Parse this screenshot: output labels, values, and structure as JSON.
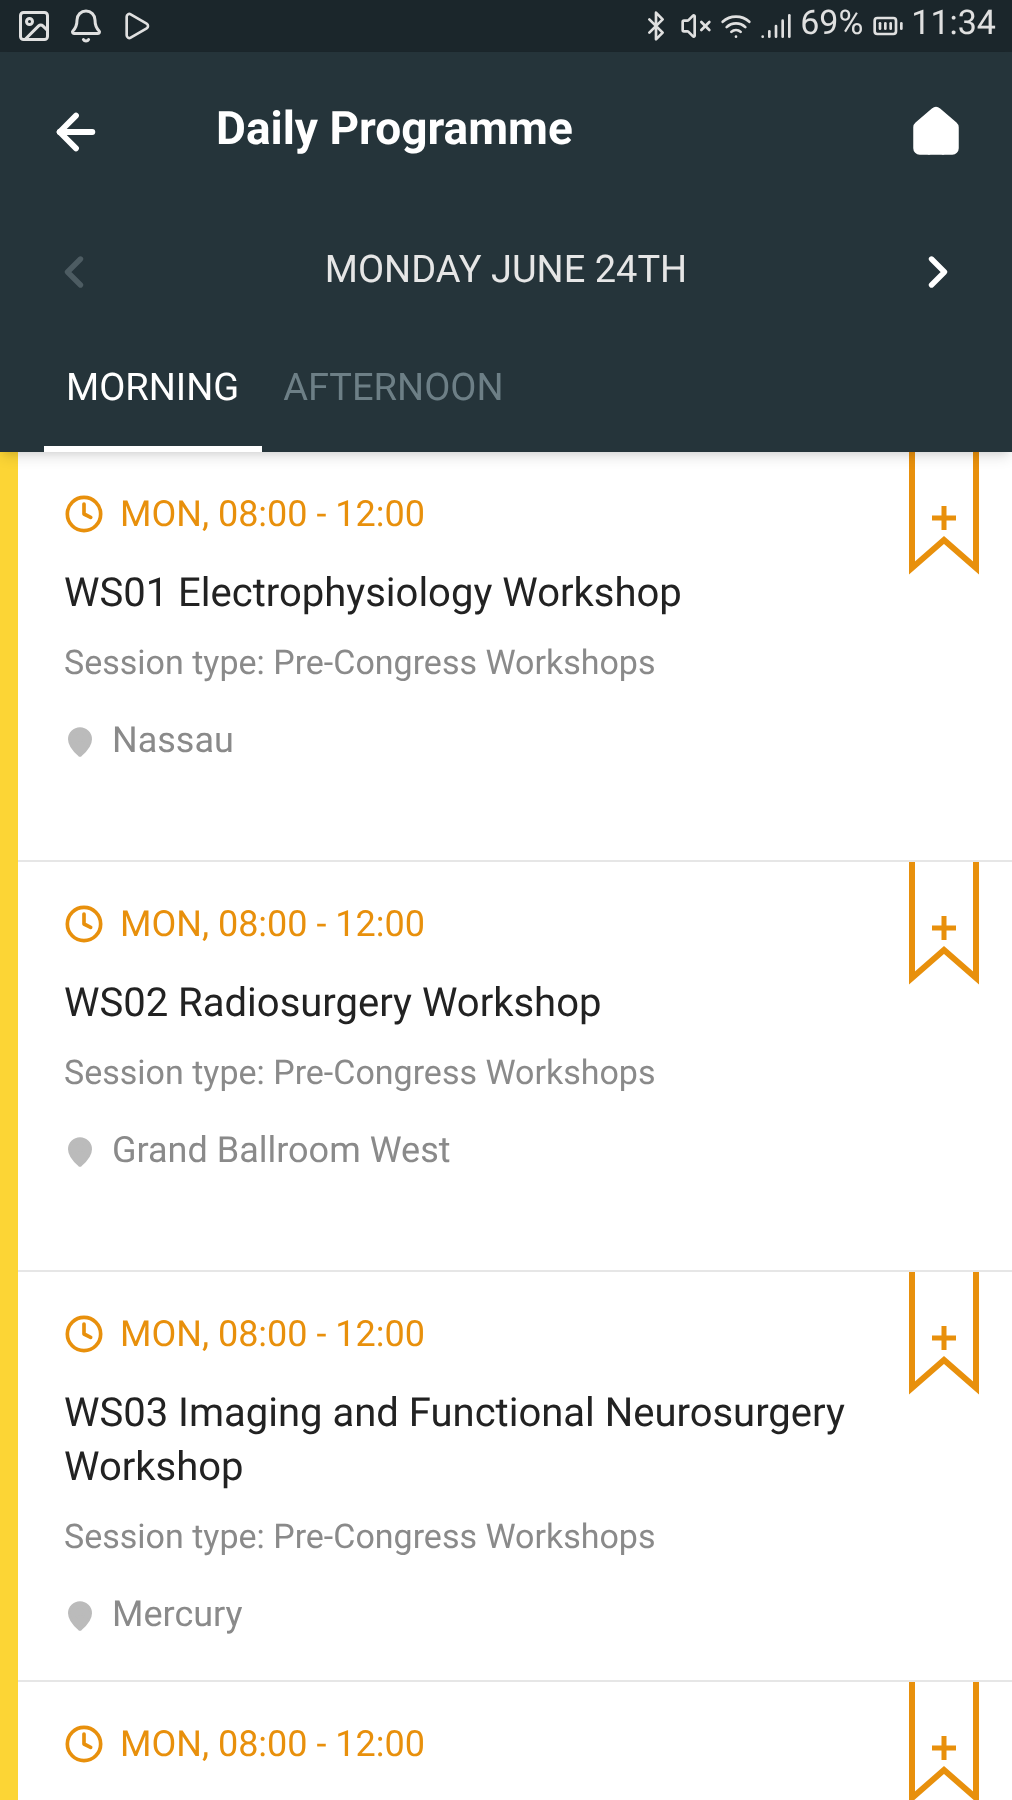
{
  "status_bar": {
    "battery": "69%",
    "time": "11:34"
  },
  "toolbar": {
    "title": "Daily Programme"
  },
  "date_nav": {
    "label": "MONDAY JUNE 24TH",
    "prev_disabled": true,
    "next_disabled": false
  },
  "tabs": [
    {
      "label": "MORNING",
      "selected": true
    },
    {
      "label": "AFTERNOON",
      "selected": false
    }
  ],
  "sessions": [
    {
      "time": "MON, 08:00 - 12:00",
      "title": "WS01 Electrophysiology Workshop",
      "session_type": "Session type: Pre-Congress Workshops",
      "location": "Nassau"
    },
    {
      "time": "MON, 08:00 - 12:00",
      "title": "WS02 Radiosurgery Workshop",
      "session_type": "Session type: Pre-Congress Workshops",
      "location": "Grand Ballroom West"
    },
    {
      "time": "MON, 08:00 - 12:00",
      "title": "WS03 Imaging and Functional Neurosurgery Workshop",
      "session_type": "Session type: Pre-Congress Workshops",
      "location": "Mercury"
    },
    {
      "time": "MON, 08:00 - 12:00"
    }
  ]
}
